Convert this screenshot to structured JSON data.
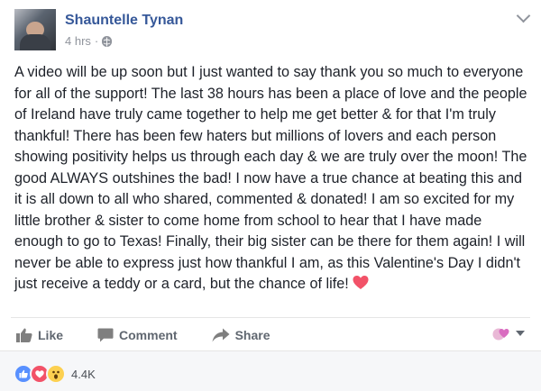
{
  "post": {
    "author": "Shauntelle Tynan",
    "timestamp": "4 hrs",
    "separator": "·",
    "text": "A video will be up soon but I just wanted to say thank you so much to everyone for all of the support! The last 38 hours has been a place of love and the people of Ireland have truly came together to help me get better & for that I'm truly thankful! There has been few haters but millions of lovers and each person showing positivity helps us through each day & we are truly over the moon! The good ALWAYS outshines the bad! I now have a true chance at beating this and it is all down to all who shared, commented & donated! I am so excited for my little brother & sister to come home from school to hear that I have made enough to go to Texas! Finally, their big sister can be there for them again! I will never be able to express just how thankful I am, as this Valentine's Day I didn't just receive a teddy or a card, but the chance of life!"
  },
  "actions": {
    "like": "Like",
    "comment": "Comment",
    "share": "Share"
  },
  "reactions": {
    "types": [
      "like",
      "love",
      "wow"
    ],
    "count": "4.4K"
  },
  "colors": {
    "author": "#365899",
    "meta": "#90949c",
    "heart": "#f25268"
  }
}
